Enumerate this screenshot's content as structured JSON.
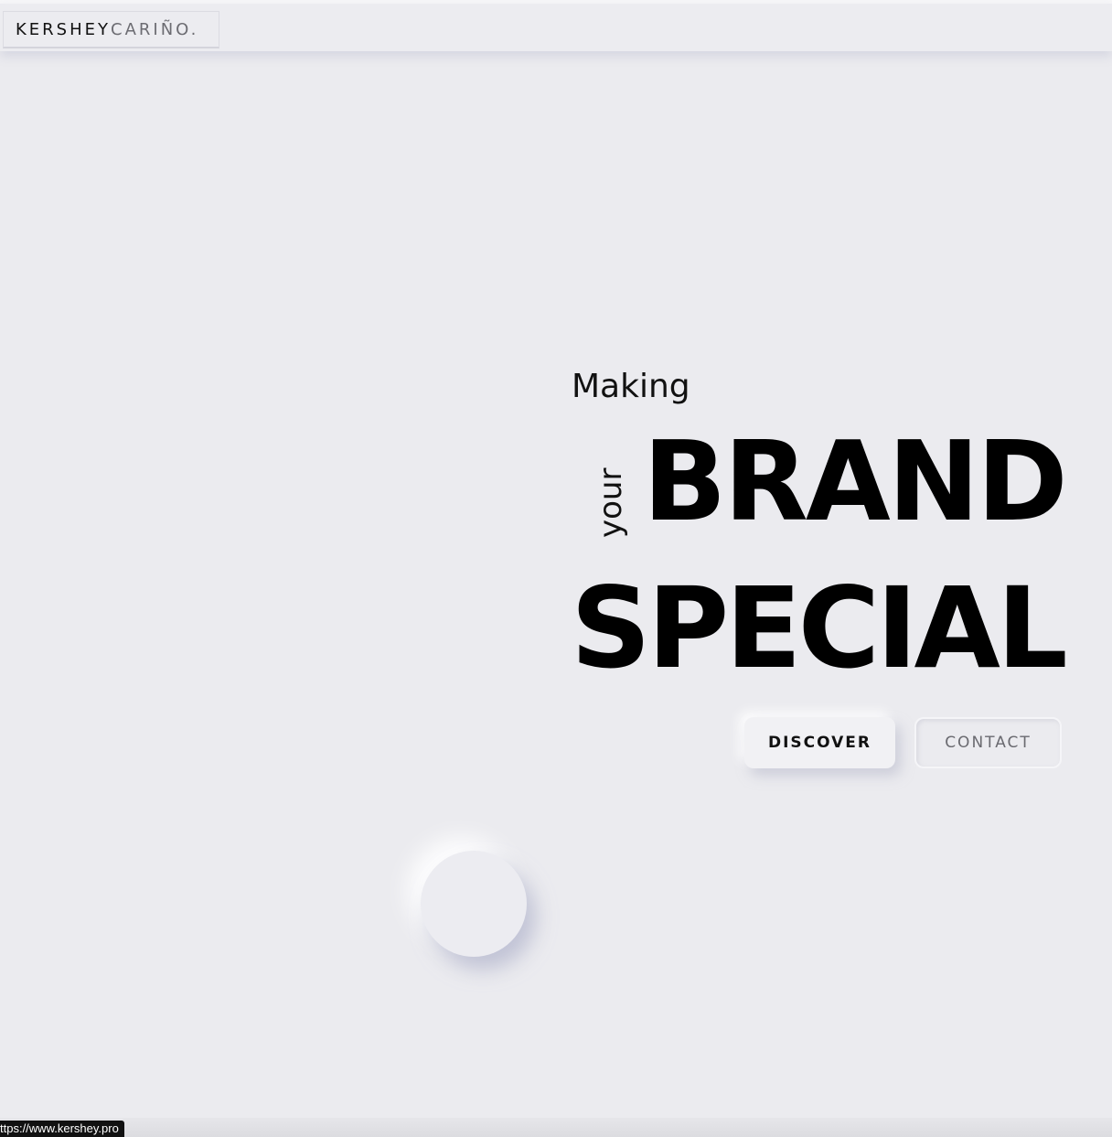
{
  "header": {
    "logo_first": "KERSHEY",
    "logo_second": "CARIÑO."
  },
  "hero": {
    "making": "Making",
    "your": "your",
    "brand": "BRAND",
    "special": "SPECIAL"
  },
  "buttons": {
    "discover": "DISCOVER",
    "contact": "CONTACT"
  },
  "status": {
    "url": "ttps://www.kershey.pro"
  },
  "colors": {
    "background": "#ebebef",
    "text": "#000000",
    "muted": "#6c6c72"
  }
}
